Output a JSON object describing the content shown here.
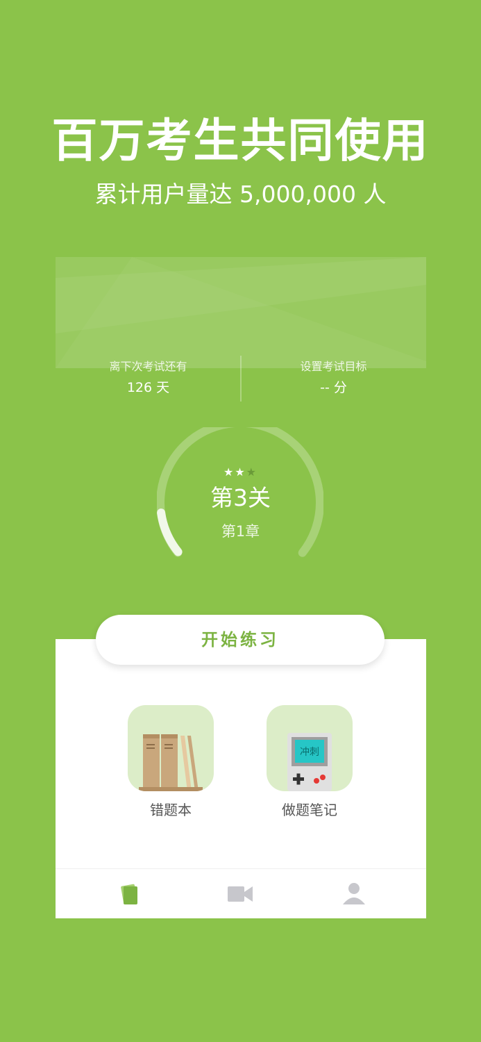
{
  "promo": {
    "headline": "百万考生共同使用",
    "subline": "累计用户量达 5,000,000 人"
  },
  "stats": {
    "countdown_label": "离下次考试还有",
    "countdown_value": "126 天",
    "goal_label": "设置考试目标",
    "goal_value": "-- 分"
  },
  "progress": {
    "stars": "★★",
    "stars_off": "★",
    "stars_total": 3,
    "stars_earned": 2,
    "level": "第3关",
    "chapter": "第1章",
    "gauge_fraction": 0.12
  },
  "actions": {
    "start_label": "开始练习",
    "tiles": [
      {
        "label": "错题本",
        "icon": "bookshelf-icon"
      },
      {
        "label": "做题笔记",
        "icon": "gameboy-icon",
        "icon_text": "冲刺"
      }
    ]
  },
  "tabbar": {
    "items": [
      {
        "icon": "cards-icon",
        "active": true
      },
      {
        "icon": "video-camera-icon",
        "active": false
      },
      {
        "icon": "user-icon",
        "active": false
      }
    ]
  },
  "colors": {
    "background": "#8bc34a",
    "accent": "#7cb342",
    "tile_bg": "#dcedc8",
    "tab_inactive": "#c7c7cc"
  }
}
